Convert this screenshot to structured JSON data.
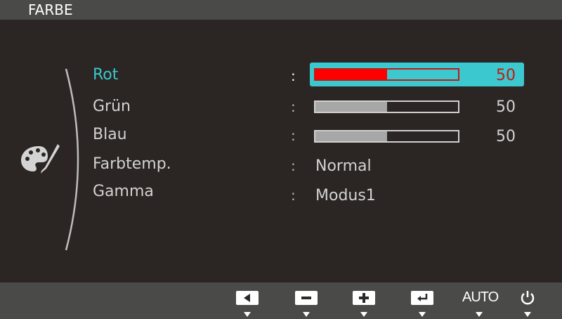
{
  "header": {
    "title": "FARBE"
  },
  "menu": {
    "items": [
      {
        "label": "Rot",
        "value": "50",
        "level": 0.5,
        "active": true
      },
      {
        "label": "Grün",
        "value": "50",
        "level": 0.5,
        "active": false
      },
      {
        "label": "Blau",
        "value": "50",
        "level": 0.5,
        "active": false
      },
      {
        "label": "Farbtemp.",
        "value": "Normal"
      },
      {
        "label": "Gamma",
        "value": "Modus1"
      }
    ],
    "separator": ":"
  },
  "footer": {
    "buttons": [
      {
        "name": "left-arrow-icon"
      },
      {
        "name": "minus-icon"
      },
      {
        "name": "plus-icon"
      },
      {
        "name": "enter-icon"
      },
      {
        "name": "auto",
        "label": "AUTO"
      },
      {
        "name": "power-icon"
      }
    ]
  },
  "colors": {
    "accent": "#3bc8ce",
    "active_fill": "#ff0000",
    "active_text": "#c21a14",
    "background": "#2b2523",
    "bar_bg": "#4a4a48"
  }
}
